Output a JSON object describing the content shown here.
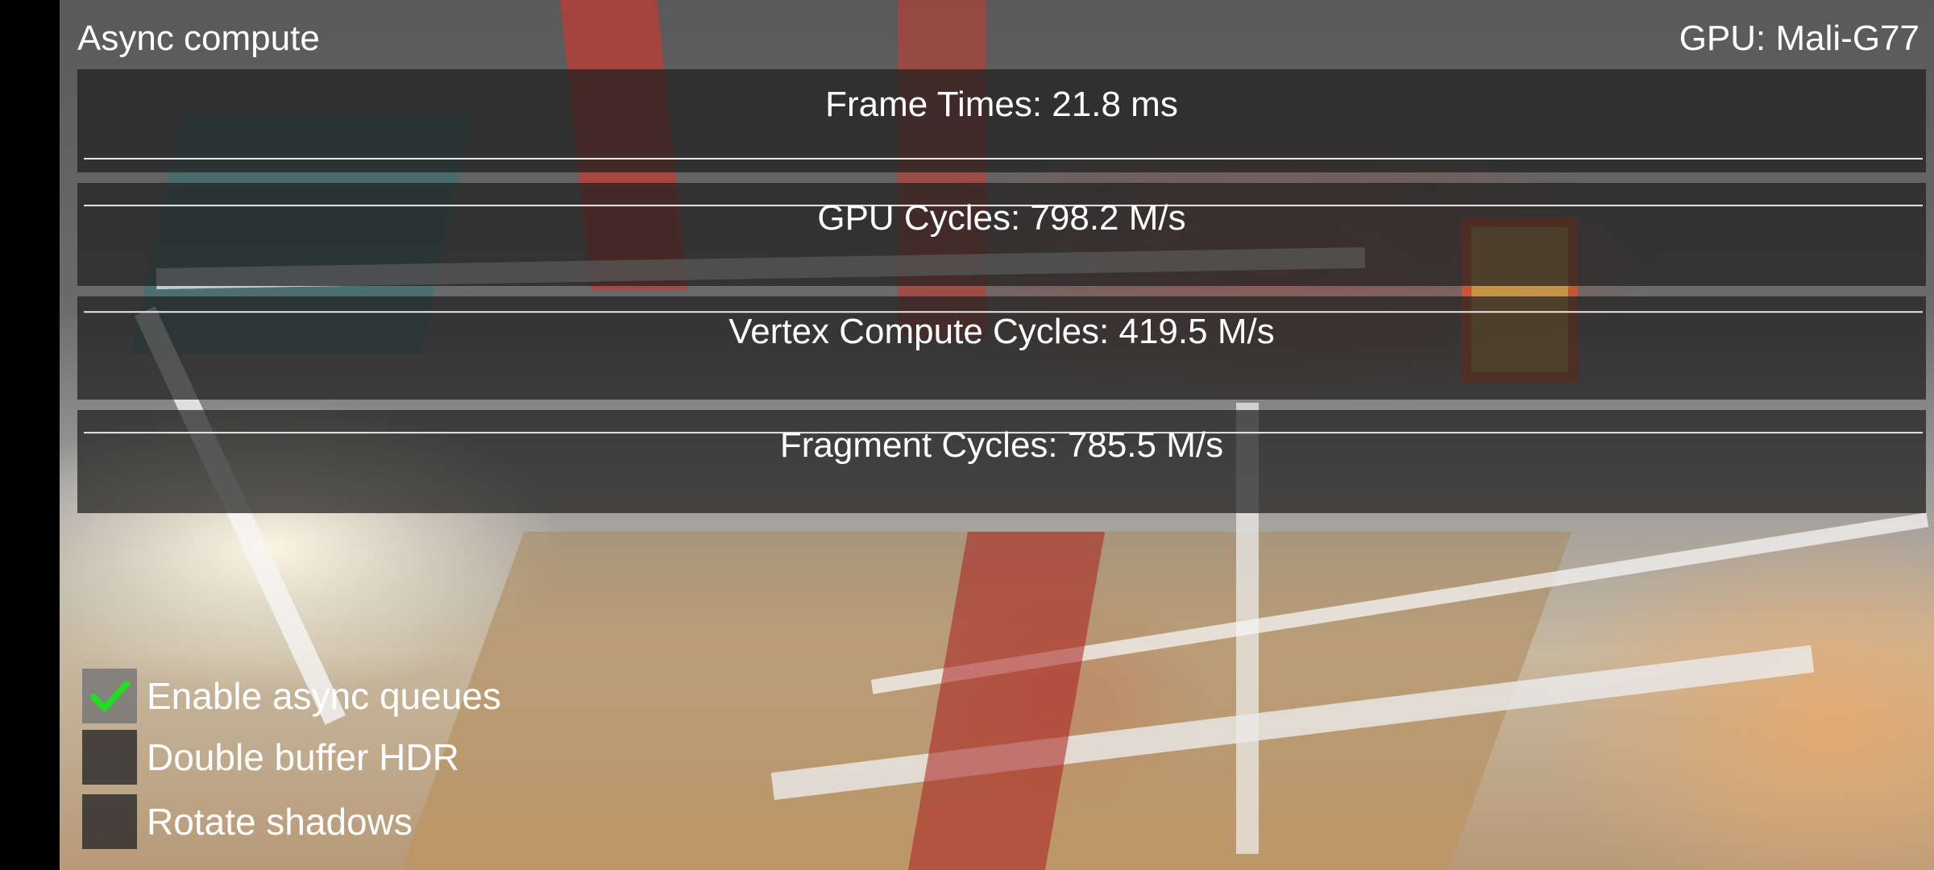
{
  "header": {
    "title": "Async compute",
    "gpu": "GPU: Mali-G77"
  },
  "graphs": [
    {
      "label": "Frame Times: 21.8 ms",
      "line_level": 0.08
    },
    {
      "label": "GPU Cycles: 798.2 M/s",
      "line_level": 0.82
    },
    {
      "label": "Vertex Compute Cycles: 419.5 M/s",
      "line_level": 0.9
    },
    {
      "label": "Fragment Cycles: 785.5 M/s",
      "line_level": 0.82
    }
  ],
  "options": [
    {
      "label": "Enable async queues",
      "checked": true
    },
    {
      "label": "Double buffer HDR",
      "checked": false
    },
    {
      "label": "Rotate shadows",
      "checked": false
    }
  ],
  "colors": {
    "check": "#22dd22",
    "graph_line": "#e8e8e8",
    "panel": "#1e1e1e"
  },
  "icons": {
    "check": "checkmark-icon"
  }
}
